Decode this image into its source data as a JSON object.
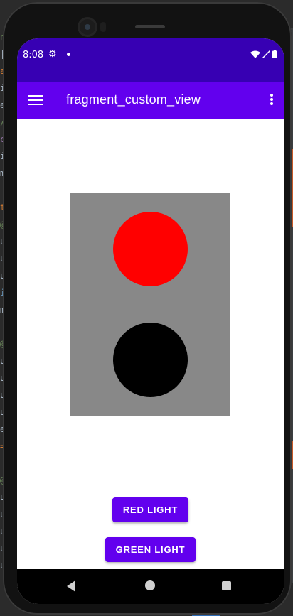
{
  "status_bar": {
    "time": "8:08",
    "icons": [
      "settings-icon",
      "notification-dot-icon",
      "wifi-icon",
      "signal-icon",
      "battery-icon"
    ]
  },
  "app_bar": {
    "title": "fragment_custom_view",
    "menu_icon": "hamburger-menu-icon",
    "overflow_icon": "more-vert-icon"
  },
  "traffic_light": {
    "top_light_color": "#ff0000",
    "bottom_light_color": "#000000",
    "housing_color": "#888888"
  },
  "buttons": {
    "red_light_label": "RED LIGHT",
    "green_light_label": "GREEN LIGHT"
  },
  "nav_bar": {
    "icons": [
      "back-icon",
      "home-icon",
      "recents-icon"
    ]
  },
  "colors": {
    "status_bar": "#3700b3",
    "app_bar": "#6200ee",
    "button": "#6200ee"
  }
}
